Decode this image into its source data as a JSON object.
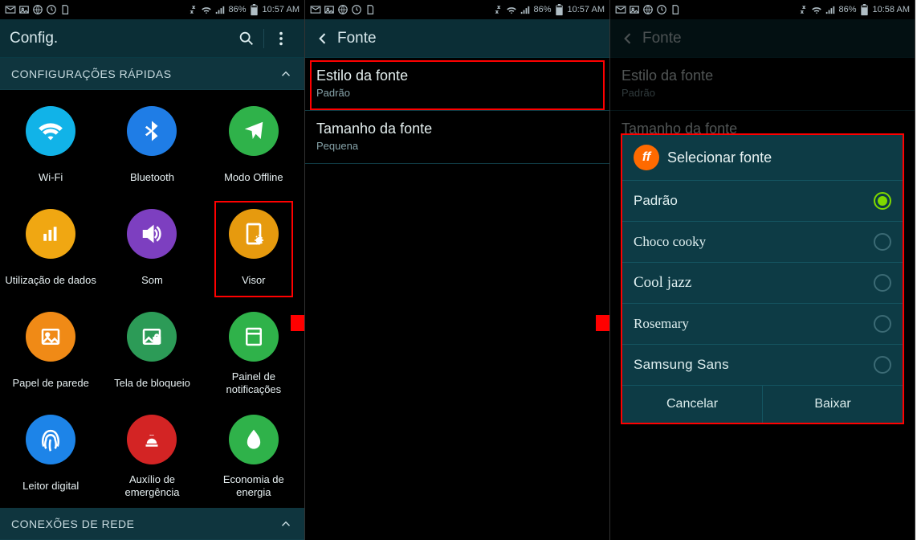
{
  "status": {
    "time_a": "10:57 AM",
    "time_b": "10:57 AM",
    "time_c": "10:58 AM",
    "battery": "86%"
  },
  "screen1": {
    "title": "Config.",
    "section": "CONFIGURAÇÕES RÁPIDAS",
    "section2": "CONEXÕES DE REDE",
    "items": {
      "wifi": "Wi-Fi",
      "bluetooth": "Bluetooth",
      "offline": "Modo Offline",
      "data": "Utilização de dados",
      "sound": "Som",
      "display": "Visor",
      "wallpaper": "Papel de parede",
      "lock": "Tela de bloqueio",
      "notif": "Painel de notificações",
      "finger": "Leitor digital",
      "emerg": "Auxílio de emergência",
      "energy": "Economia de energia"
    }
  },
  "screen2": {
    "title": "Fonte",
    "style_title": "Estilo da fonte",
    "style_sub": "Padrão",
    "size_title": "Tamanho da fonte",
    "size_sub": "Pequena"
  },
  "screen3": {
    "title": "Fonte",
    "style_title": "Estilo da fonte",
    "style_sub": "Padrão",
    "size_title": "Tamanho da fonte",
    "dialog_title": "Selecionar fonte",
    "options": {
      "default": "Padrão",
      "choco": "Choco cooky",
      "cool": "Cool jazz",
      "rose": "Rosemary",
      "sams": "Samsung Sans"
    },
    "cancel": "Cancelar",
    "download": "Baixar"
  }
}
